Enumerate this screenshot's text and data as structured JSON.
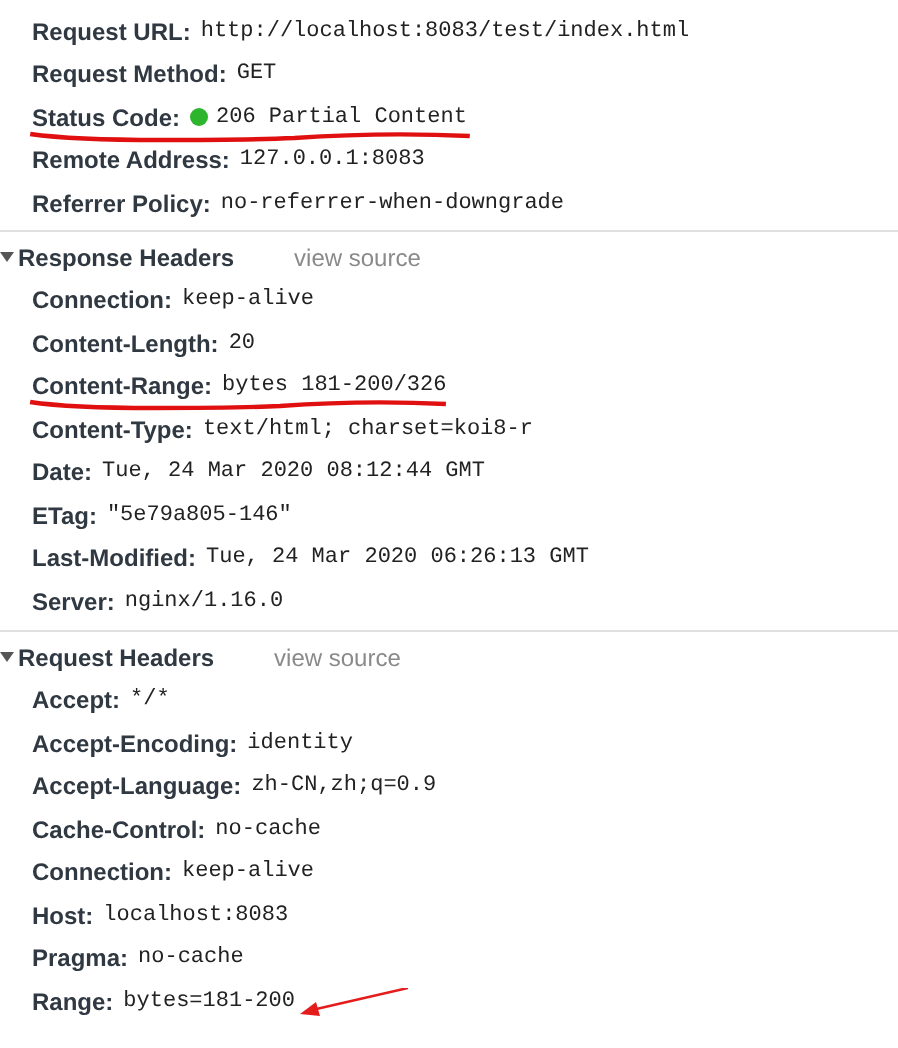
{
  "general": {
    "rows": [
      {
        "label": "Request URL:",
        "value": "http://localhost:8083/test/index.html"
      },
      {
        "label": "Request Method:",
        "value": "GET"
      },
      {
        "label": "Status Code:",
        "value": "206 Partial Content",
        "color": "#2db52d",
        "underlined": true
      },
      {
        "label": "Remote Address:",
        "value": "127.0.0.1:8083"
      },
      {
        "label": "Referrer Policy:",
        "value": "no-referrer-when-downgrade"
      }
    ]
  },
  "sections": [
    {
      "title": "Response Headers",
      "expanded": true,
      "link": "view source",
      "rows": [
        {
          "label": "Connection:",
          "value": "keep-alive"
        },
        {
          "label": "Content-Length:",
          "value": "20"
        },
        {
          "label": "Content-Range:",
          "value": "bytes 181-200/326",
          "underlined": true
        },
        {
          "label": "Content-Type:",
          "value": "text/html; charset=koi8-r"
        },
        {
          "label": "Date:",
          "value": "Tue, 24 Mar 2020 08:12:44 GMT"
        },
        {
          "label": "ETag:",
          "value": "\"5e79a805-146\""
        },
        {
          "label": "Last-Modified:",
          "value": "Tue, 24 Mar 2020 06:26:13 GMT"
        },
        {
          "label": "Server:",
          "value": "nginx/1.16.0"
        }
      ]
    },
    {
      "title": "Request Headers",
      "expanded": true,
      "link": "view source",
      "rows": [
        {
          "label": "Accept:",
          "value": "*/*"
        },
        {
          "label": "Accept-Encoding:",
          "value": "identity"
        },
        {
          "label": "Accept-Language:",
          "value": "zh-CN,zh;q=0.9"
        },
        {
          "label": "Cache-Control:",
          "value": "no-cache"
        },
        {
          "label": "Connection:",
          "value": "keep-alive"
        },
        {
          "label": "Host:",
          "value": "localhost:8083"
        },
        {
          "label": "Pragma:",
          "value": "no-cache"
        },
        {
          "label": "Range:",
          "value": "bytes=181-200",
          "arrow_pointed": true
        }
      ]
    }
  ]
}
